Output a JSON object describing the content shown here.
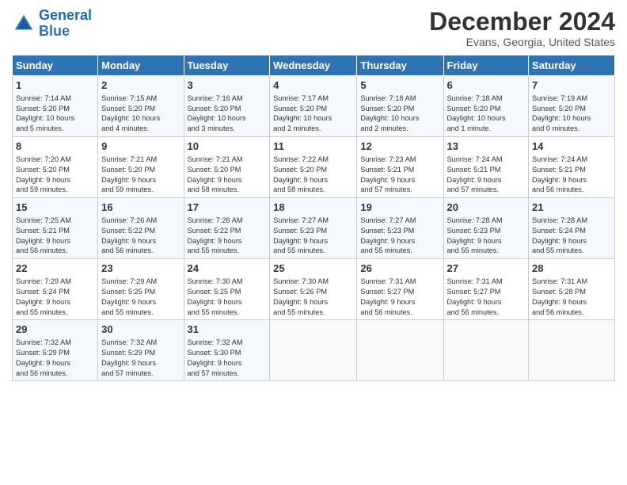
{
  "header": {
    "logo_line1": "General",
    "logo_line2": "Blue",
    "month": "December 2024",
    "location": "Evans, Georgia, United States"
  },
  "columns": [
    "Sunday",
    "Monday",
    "Tuesday",
    "Wednesday",
    "Thursday",
    "Friday",
    "Saturday"
  ],
  "weeks": [
    [
      {
        "day": "1",
        "lines": [
          "Sunrise: 7:14 AM",
          "Sunset: 5:20 PM",
          "Daylight: 10 hours",
          "and 5 minutes."
        ]
      },
      {
        "day": "2",
        "lines": [
          "Sunrise: 7:15 AM",
          "Sunset: 5:20 PM",
          "Daylight: 10 hours",
          "and 4 minutes."
        ]
      },
      {
        "day": "3",
        "lines": [
          "Sunrise: 7:16 AM",
          "Sunset: 5:20 PM",
          "Daylight: 10 hours",
          "and 3 minutes."
        ]
      },
      {
        "day": "4",
        "lines": [
          "Sunrise: 7:17 AM",
          "Sunset: 5:20 PM",
          "Daylight: 10 hours",
          "and 2 minutes."
        ]
      },
      {
        "day": "5",
        "lines": [
          "Sunrise: 7:18 AM",
          "Sunset: 5:20 PM",
          "Daylight: 10 hours",
          "and 2 minutes."
        ]
      },
      {
        "day": "6",
        "lines": [
          "Sunrise: 7:18 AM",
          "Sunset: 5:20 PM",
          "Daylight: 10 hours",
          "and 1 minute."
        ]
      },
      {
        "day": "7",
        "lines": [
          "Sunrise: 7:19 AM",
          "Sunset: 5:20 PM",
          "Daylight: 10 hours",
          "and 0 minutes."
        ]
      }
    ],
    [
      {
        "day": "8",
        "lines": [
          "Sunrise: 7:20 AM",
          "Sunset: 5:20 PM",
          "Daylight: 9 hours",
          "and 59 minutes."
        ]
      },
      {
        "day": "9",
        "lines": [
          "Sunrise: 7:21 AM",
          "Sunset: 5:20 PM",
          "Daylight: 9 hours",
          "and 59 minutes."
        ]
      },
      {
        "day": "10",
        "lines": [
          "Sunrise: 7:21 AM",
          "Sunset: 5:20 PM",
          "Daylight: 9 hours",
          "and 58 minutes."
        ]
      },
      {
        "day": "11",
        "lines": [
          "Sunrise: 7:22 AM",
          "Sunset: 5:20 PM",
          "Daylight: 9 hours",
          "and 58 minutes."
        ]
      },
      {
        "day": "12",
        "lines": [
          "Sunrise: 7:23 AM",
          "Sunset: 5:21 PM",
          "Daylight: 9 hours",
          "and 57 minutes."
        ]
      },
      {
        "day": "13",
        "lines": [
          "Sunrise: 7:24 AM",
          "Sunset: 5:21 PM",
          "Daylight: 9 hours",
          "and 57 minutes."
        ]
      },
      {
        "day": "14",
        "lines": [
          "Sunrise: 7:24 AM",
          "Sunset: 5:21 PM",
          "Daylight: 9 hours",
          "and 56 minutes."
        ]
      }
    ],
    [
      {
        "day": "15",
        "lines": [
          "Sunrise: 7:25 AM",
          "Sunset: 5:21 PM",
          "Daylight: 9 hours",
          "and 56 minutes."
        ]
      },
      {
        "day": "16",
        "lines": [
          "Sunrise: 7:26 AM",
          "Sunset: 5:22 PM",
          "Daylight: 9 hours",
          "and 56 minutes."
        ]
      },
      {
        "day": "17",
        "lines": [
          "Sunrise: 7:26 AM",
          "Sunset: 5:22 PM",
          "Daylight: 9 hours",
          "and 55 minutes."
        ]
      },
      {
        "day": "18",
        "lines": [
          "Sunrise: 7:27 AM",
          "Sunset: 5:23 PM",
          "Daylight: 9 hours",
          "and 55 minutes."
        ]
      },
      {
        "day": "19",
        "lines": [
          "Sunrise: 7:27 AM",
          "Sunset: 5:23 PM",
          "Daylight: 9 hours",
          "and 55 minutes."
        ]
      },
      {
        "day": "20",
        "lines": [
          "Sunrise: 7:28 AM",
          "Sunset: 5:23 PM",
          "Daylight: 9 hours",
          "and 55 minutes."
        ]
      },
      {
        "day": "21",
        "lines": [
          "Sunrise: 7:28 AM",
          "Sunset: 5:24 PM",
          "Daylight: 9 hours",
          "and 55 minutes."
        ]
      }
    ],
    [
      {
        "day": "22",
        "lines": [
          "Sunrise: 7:29 AM",
          "Sunset: 5:24 PM",
          "Daylight: 9 hours",
          "and 55 minutes."
        ]
      },
      {
        "day": "23",
        "lines": [
          "Sunrise: 7:29 AM",
          "Sunset: 5:25 PM",
          "Daylight: 9 hours",
          "and 55 minutes."
        ]
      },
      {
        "day": "24",
        "lines": [
          "Sunrise: 7:30 AM",
          "Sunset: 5:25 PM",
          "Daylight: 9 hours",
          "and 55 minutes."
        ]
      },
      {
        "day": "25",
        "lines": [
          "Sunrise: 7:30 AM",
          "Sunset: 5:26 PM",
          "Daylight: 9 hours",
          "and 55 minutes."
        ]
      },
      {
        "day": "26",
        "lines": [
          "Sunrise: 7:31 AM",
          "Sunset: 5:27 PM",
          "Daylight: 9 hours",
          "and 56 minutes."
        ]
      },
      {
        "day": "27",
        "lines": [
          "Sunrise: 7:31 AM",
          "Sunset: 5:27 PM",
          "Daylight: 9 hours",
          "and 56 minutes."
        ]
      },
      {
        "day": "28",
        "lines": [
          "Sunrise: 7:31 AM",
          "Sunset: 5:28 PM",
          "Daylight: 9 hours",
          "and 56 minutes."
        ]
      }
    ],
    [
      {
        "day": "29",
        "lines": [
          "Sunrise: 7:32 AM",
          "Sunset: 5:29 PM",
          "Daylight: 9 hours",
          "and 56 minutes."
        ]
      },
      {
        "day": "30",
        "lines": [
          "Sunrise: 7:32 AM",
          "Sunset: 5:29 PM",
          "Daylight: 9 hours",
          "and 57 minutes."
        ]
      },
      {
        "day": "31",
        "lines": [
          "Sunrise: 7:32 AM",
          "Sunset: 5:30 PM",
          "Daylight: 9 hours",
          "and 57 minutes."
        ]
      },
      {
        "day": "",
        "lines": []
      },
      {
        "day": "",
        "lines": []
      },
      {
        "day": "",
        "lines": []
      },
      {
        "day": "",
        "lines": []
      }
    ]
  ]
}
